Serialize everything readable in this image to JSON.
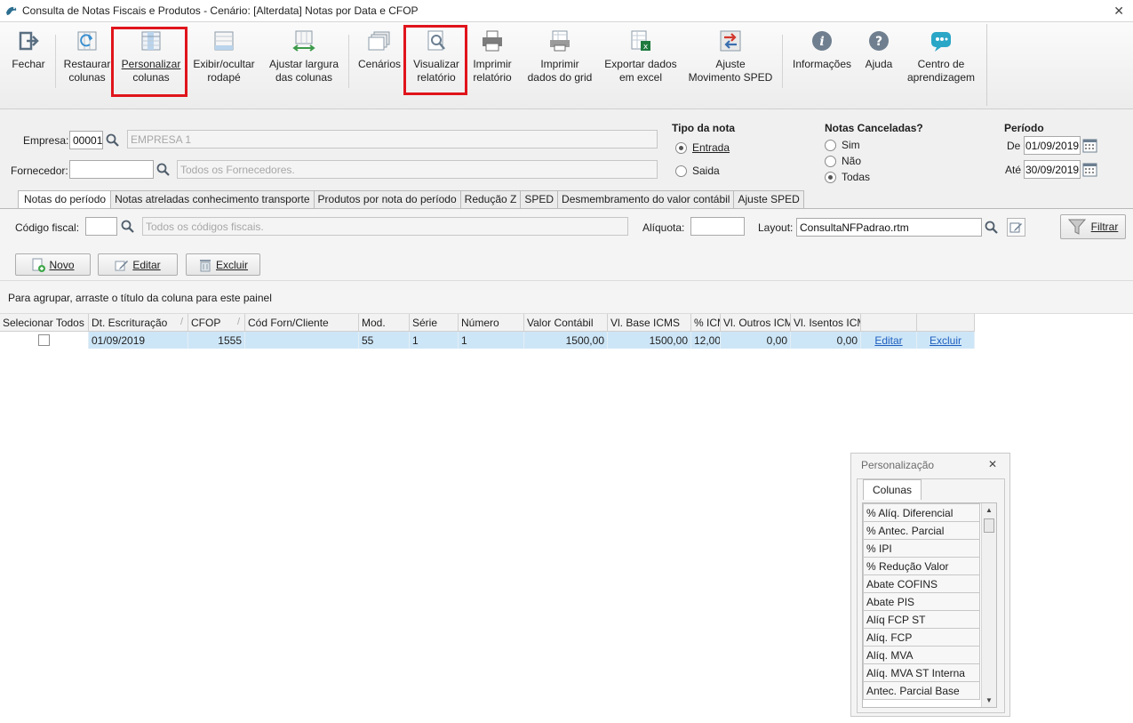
{
  "window": {
    "title": "Consulta de Notas Fiscais e Produtos - Cenário: [Alterdata] Notas por Data e CFOP",
    "close_glyph": "✕"
  },
  "toolbar": {
    "fechar": "Fechar",
    "restaurar_1": "Restaurar",
    "restaurar_2": "colunas",
    "personalizar_1": "Personalizar",
    "personalizar_2": "colunas",
    "exibir_1": "Exibir/ocultar",
    "exibir_2": "rodapé",
    "ajustar_1": "Ajustar largura",
    "ajustar_2": "das colunas",
    "cenarios": "Cenários",
    "visualizar_1": "Visualizar",
    "visualizar_2": "relatório",
    "imprimir_rel_1": "Imprimir",
    "imprimir_rel_2": "relatório",
    "imprimir_grid_1": "Imprimir",
    "imprimir_grid_2": "dados do grid",
    "exportar_1": "Exportar dados",
    "exportar_2": "em excel",
    "ajuste_1": "Ajuste",
    "ajuste_2": "Movimento SPED",
    "informacoes": "Informações",
    "ajuda": "Ajuda",
    "centro_1": "Centro de",
    "centro_2": "aprendizagem"
  },
  "filters": {
    "empresa_label": "Empresa:",
    "empresa_code": "00001",
    "empresa_name": "EMPRESA 1",
    "fornecedor_label": "Fornecedor:",
    "fornecedor_code": "",
    "fornecedor_placeholder": "Todos os Fornecedores.",
    "tipo_nota_title": "Tipo da nota",
    "tipo_entrada": "Entrada",
    "tipo_saida": "Saida",
    "canceladas_title": "Notas Canceladas?",
    "canc_sim": "Sim",
    "canc_nao": "Não",
    "canc_todas": "Todas",
    "periodo_title": "Período",
    "de_label": "De",
    "de_value": "01/09/2019",
    "ate_label": "Até",
    "ate_value": "30/09/2019"
  },
  "tabs": [
    "Notas do período",
    "Notas atreladas conhecimento transporte",
    "Produtos por nota do período",
    "Redução Z",
    "SPED",
    "Desmembramento do valor contábil",
    "Ajuste SPED"
  ],
  "panel": {
    "codigo_fiscal_label": "Código fiscal:",
    "codigo_fiscal_value": "",
    "codigo_fiscal_placeholder": "Todos os códigos fiscais.",
    "aliquota_label": "Alíquota:",
    "aliquota_value": "",
    "layout_label": "Layout:",
    "layout_value": "ConsultaNFPadrao.rtm",
    "filtrar": "Filtrar",
    "novo": "Novo",
    "editar": "Editar",
    "excluir": "Excluir",
    "group_hint": "Para agrupar, arraste o título da coluna para este painel"
  },
  "grid": {
    "headers": [
      "Selecionar Todos",
      "Dt. Escrituração",
      "CFOP",
      "Cód Forn/Cliente",
      "Mod.",
      "Série",
      "Número",
      "Valor Contábil",
      "Vl. Base ICMS",
      "% ICMS",
      "Vl. Outros ICMS",
      "Vl. Isentos ICMS",
      "",
      ""
    ],
    "sort_glyph": "/",
    "row": {
      "dt": "01/09/2019",
      "cfop": "1555",
      "cod": "",
      "mod": "55",
      "serie": "1",
      "numero": "1",
      "valor": "1500,00",
      "base": "1500,00",
      "icms": "12,00",
      "outros": "0,00",
      "isentos": "0,00",
      "editar": "Editar",
      "excluir": "Excluir"
    }
  },
  "personalizacao": {
    "title": "Personalização",
    "close_glyph": "✕",
    "tab": "Colunas",
    "items": [
      "% Alíq. Diferencial",
      "% Antec. Parcial",
      "% IPI",
      "% Redução Valor",
      "Abate COFINS",
      "Abate PIS",
      "Alíq FCP ST",
      "Alíq. FCP",
      "Alíq. MVA",
      "Alíq. MVA ST Interna",
      "Antec. Parcial Base"
    ],
    "scroll_up": "▲",
    "scroll_down": "▼"
  },
  "colors": {
    "highlight_box": "#e0141c",
    "selected_row": "#cde6f7",
    "link": "#1f5fbf"
  }
}
